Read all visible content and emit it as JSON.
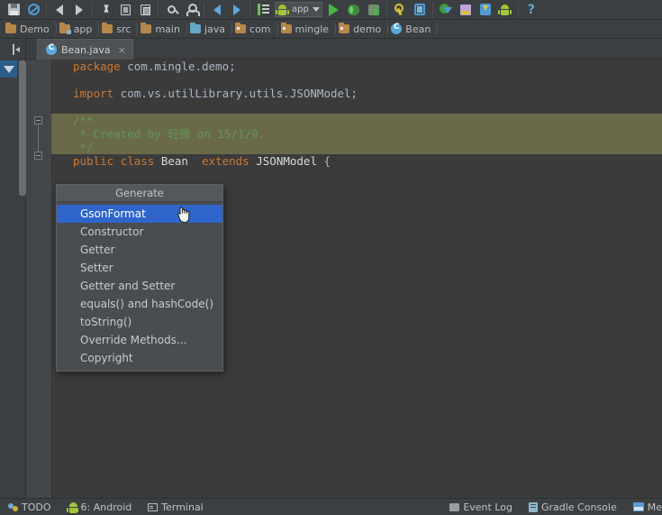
{
  "toolbar": {
    "icons": [
      {
        "name": "save-all-icon",
        "title": "Save All"
      },
      {
        "name": "sync-icon",
        "title": "Synchronize"
      },
      {
        "name": "undo-icon",
        "title": "Undo"
      },
      {
        "name": "redo-icon",
        "title": "Redo"
      },
      {
        "name": "cut-icon",
        "title": "Cut"
      },
      {
        "name": "copy-icon",
        "title": "Copy"
      },
      {
        "name": "paste-icon",
        "title": "Paste"
      },
      {
        "name": "find-icon",
        "title": "Find"
      },
      {
        "name": "find-usages-icon",
        "title": "Find Usages"
      },
      {
        "name": "back-icon",
        "title": "Back"
      },
      {
        "name": "forward-icon",
        "title": "Forward"
      },
      {
        "name": "structure-icon",
        "title": "Structure"
      }
    ],
    "run_config": {
      "icon": "android-icon",
      "label": "app",
      "caret": "chevron-down-icon"
    },
    "run_icons": [
      {
        "name": "run-icon",
        "title": "Run"
      },
      {
        "name": "debug-icon",
        "title": "Debug"
      },
      {
        "name": "run-coverage-icon",
        "title": "Run with Coverage"
      },
      {
        "name": "project-structure-icon",
        "title": "Project Structure"
      },
      {
        "name": "avd-manager-icon",
        "title": "AVD Manager"
      },
      {
        "name": "sdk-manager-icon",
        "title": "SDK Manager"
      },
      {
        "name": "android-monitor-icon",
        "title": "Android Monitor"
      },
      {
        "name": "update-icon",
        "title": "Update"
      },
      {
        "name": "android-device-icon",
        "title": "Android Device"
      },
      {
        "name": "help-icon",
        "title": "Help"
      }
    ]
  },
  "breadcrumb": {
    "items": [
      {
        "label": "Demo",
        "icon": "project-icon"
      },
      {
        "label": "app",
        "icon": "module-folder-icon"
      },
      {
        "label": "src",
        "icon": "folder-icon"
      },
      {
        "label": "main",
        "icon": "folder-icon"
      },
      {
        "label": "java",
        "icon": "source-folder-icon"
      },
      {
        "label": "com",
        "icon": "package-folder-icon"
      },
      {
        "label": "mingle",
        "icon": "package-folder-icon"
      },
      {
        "label": "demo",
        "icon": "package-folder-icon"
      },
      {
        "label": "Bean",
        "icon": "class-icon"
      }
    ]
  },
  "left_rail": {
    "hide_icon": "hide-panel-icon",
    "filter_icon": "triangle-down-icon"
  },
  "tabs": [
    {
      "label": "Bean.java",
      "icon": "class-icon",
      "close": "×",
      "active": true
    }
  ],
  "editor": {
    "lines": [
      {
        "type": "code",
        "tokens": [
          {
            "t": "package",
            "c": "kw"
          },
          {
            "t": " com.mingle.demo;",
            "c": "punct"
          }
        ]
      },
      {
        "type": "blank"
      },
      {
        "type": "code",
        "tokens": [
          {
            "t": "import",
            "c": "kw"
          },
          {
            "t": " com.vs.utilLibrary.utils.JSONModel;",
            "c": "punct"
          }
        ]
      },
      {
        "type": "blank"
      },
      {
        "type": "comment",
        "highlight": true,
        "tokens": [
          {
            "t": "/**",
            "c": "cmt"
          }
        ]
      },
      {
        "type": "comment",
        "highlight": true,
        "tokens": [
          {
            "t": " * Created by 轻微 on 15/1/9.",
            "c": "cmt"
          }
        ]
      },
      {
        "type": "comment",
        "highlight": true,
        "tokens": [
          {
            "t": " */",
            "c": "cmt"
          }
        ]
      },
      {
        "type": "code",
        "tokens": [
          {
            "t": "public",
            "c": "kw"
          },
          {
            "t": " ",
            "c": "punct"
          },
          {
            "t": "class",
            "c": "kw"
          },
          {
            "t": " ",
            "c": "punct"
          },
          {
            "t": "Bean",
            "c": "cls"
          },
          {
            "t": "  ",
            "c": "punct"
          },
          {
            "t": "extends",
            "c": "kw"
          },
          {
            "t": " ",
            "c": "punct"
          },
          {
            "t": "JSONModel",
            "c": "cls"
          },
          {
            "t": " {",
            "c": "punct"
          }
        ]
      }
    ]
  },
  "popup": {
    "title": "Generate",
    "items": [
      {
        "label": "GsonFormat",
        "selected": true
      },
      {
        "label": "Constructor",
        "selected": false
      },
      {
        "label": "Getter",
        "selected": false
      },
      {
        "label": "Setter",
        "selected": false
      },
      {
        "label": "Getter and Setter",
        "selected": false
      },
      {
        "label": "equals() and hashCode()",
        "selected": false
      },
      {
        "label": "toString()",
        "selected": false
      },
      {
        "label": "Override Methods...",
        "selected": false
      },
      {
        "label": "Copyright",
        "selected": false
      }
    ],
    "cursor": "hand-pointer-cursor"
  },
  "statusbar": {
    "left": [
      {
        "label": "TODO",
        "icon": "todo-icon"
      },
      {
        "label": "6: Android",
        "icon": "android-icon"
      },
      {
        "label": "Terminal",
        "icon": "terminal-icon"
      }
    ],
    "right": [
      {
        "label": "Event Log",
        "icon": "event-log-icon"
      },
      {
        "label": "Gradle Console",
        "icon": "gradle-console-icon"
      },
      {
        "label": "Me",
        "icon": "memory-icon"
      }
    ]
  },
  "colors": {
    "accent_selection": "#2f65ca",
    "comment_green": "#629755",
    "keyword_orange": "#cc7832",
    "comment_highlight": "#6a6a4a",
    "editor_bg": "#3b3b3b",
    "chrome_bg": "#3c3f41"
  }
}
